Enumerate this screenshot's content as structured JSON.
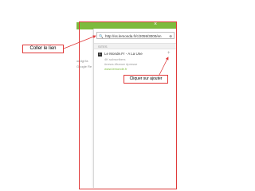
{
  "background_lines": [
    "onrigt fa",
    "Google Re"
  ],
  "popup": {
    "close_glyph": "×",
    "url_field": {
      "value": "http://ss.lemonda.fr/c/2059/3000/en",
      "search_glyph": "🔍",
      "add_glyph": "⊕"
    },
    "section_label": "SITES",
    "result": {
      "favicon": "L",
      "title": "Le Monde.Fr - A La Une",
      "lines": [
        "4K subscribers",
        "#news #france #presse"
      ],
      "url": "www.lemonde.fr",
      "add_glyph": "+"
    }
  },
  "annotations": {
    "paste_link": "Coller le lien",
    "click_add": "Cliquer sur ajouter",
    "color": "#e03a3a"
  }
}
